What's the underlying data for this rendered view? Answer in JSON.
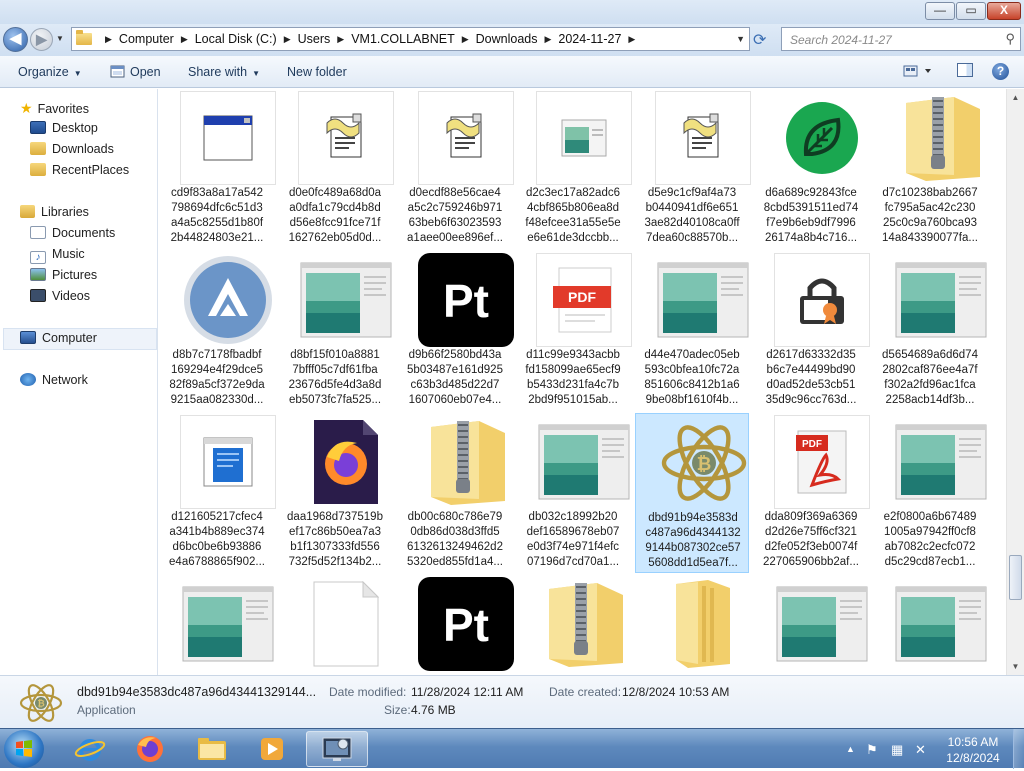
{
  "window": {
    "min_label": "—",
    "max_label": "▭",
    "close_label": "X"
  },
  "navbar": {
    "breadcrumbs": [
      "Computer",
      "Local Disk (C:)",
      "Users",
      "VM1.COLLABNET",
      "Downloads",
      "2024-11-27"
    ],
    "search_placeholder": "Search 2024-11-27"
  },
  "toolbar": {
    "organize_label": "Organize",
    "open_label": "Open",
    "share_label": "Share with",
    "new_folder_label": "New folder",
    "help_label": "?"
  },
  "sidebar": {
    "favorites": "Favorites",
    "favorites_items": [
      "Desktop",
      "Downloads",
      "RecentPlaces"
    ],
    "libraries": "Libraries",
    "library_items": [
      "Documents",
      "Music",
      "Pictures",
      "Videos"
    ],
    "computer": "Computer",
    "network": "Network"
  },
  "files": [
    {
      "name": "cd9f83a8a17a542\n798694dfc6c51d3\na4a5c8255d1b80f\n2b44824803e21...",
      "icon": "window-app-icon"
    },
    {
      "name": "d0e0fc489a68d0a\na0dfa1c79cd4b8d\nd56e8fcc91fce71f\n162762eb05d0d...",
      "icon": "script-icon"
    },
    {
      "name": "d0ecdf88e56cae4\na5c2c759246b971\n63beb6f63023593\na1aee00ee896ef...",
      "icon": "script-icon"
    },
    {
      "name": "d2c3ec17a82adc6\n4cbf865b806ea8d\nf48efcee31a55e5e\ne6e61de3dccbb...",
      "icon": "screenshot-small-icon"
    },
    {
      "name": "d5e9c1cf9af4a73\nb0440941df6e651\n3ae82d40108ca0ff\n7dea60c88570b...",
      "icon": "script-icon"
    },
    {
      "name": "d6a689c92843fce\n8cbd5391511ed74\nf7e9b6eb9df7996\n26174a8b4c716...",
      "icon": "leaf-app-icon"
    },
    {
      "name": "d7c10238bab2667\nfc795a5ac42c230\n25c0c9a760bca93\n14a843390077fa...",
      "icon": "zip-folder-icon"
    },
    {
      "name": "d8b7c7178fbadbf\n169294e4f29dce5\n82f89a5cf372e9da\n9215aa082330d...",
      "icon": "circle-logo-icon"
    },
    {
      "name": "d8bf15f010a8881\n7bfff05c7df61fba\n23676d5fe4d3a8d\neb5073fc7fa525...",
      "icon": "screenshot-icon"
    },
    {
      "name": "d9b66f2580bd43a\n5b03487e161d925\nc63b3d485d22d7\n1607060eb07e4...",
      "icon": "pt-app-icon"
    },
    {
      "name": "d11c99e9343acbb\nfd158099ae65ecf9\nb5433d231fa4c7b\n2bd9f951015ab...",
      "icon": "pdf-icon"
    },
    {
      "name": "d44e470adec05eb\n593c0bfea10fc72a\n851606c8412b1a6\n9be08bf1610f4b...",
      "icon": "screenshot-icon"
    },
    {
      "name": "d2617d63332d35\nb6c7e44499bd90\nd0ad52de53cb51\n35d9c96cc763d...",
      "icon": "certificate-lock-icon"
    },
    {
      "name": "d5654689a6d6d74\n2802caf876ee4a7f\nf302a2fd96ac1fca\n2258acb14df3b...",
      "icon": "screenshot-icon"
    },
    {
      "name": "d121605217cfec4\na341b4b889ec374\nd6bc0be6b93886\ne4a6788865f902...",
      "icon": "doc-window-icon"
    },
    {
      "name": "daa1968d737519b\nef17c86b50ea7a3\nb1f1307333fd556\n732f5d52f134b2...",
      "icon": "firefox-file-icon"
    },
    {
      "name": "db00c680c786e79\n0db86d038d3ffd5\n6132613249462d2\n5320ed855fd1a4...",
      "icon": "zip-folder-icon"
    },
    {
      "name": "db032c18992b20\ndef16589678eb07\ne0d3f74e971f4efc\n07196d7cd70a1...",
      "icon": "screenshot-icon"
    },
    {
      "name": "dbd91b94e3583d\nc487a96d4344132\n9144b087302ce57\n5608dd1d5ea7f...",
      "icon": "atom-app-icon",
      "selected": true
    },
    {
      "name": "dda809f369a6369\nd2d26e75ff6cf321\nd2fe052f3eb0074f\n227065906bb2af...",
      "icon": "pdf-acrobat-icon"
    },
    {
      "name": "e2f0800a6b67489\n1005a97942ff0cf8\nab7082c2ecfc072\nd5c29cd87ecb1...",
      "icon": "screenshot-icon"
    },
    {
      "name": "",
      "icon": "screenshot-icon"
    },
    {
      "name": "",
      "icon": "blank-file-icon"
    },
    {
      "name": "",
      "icon": "pt-app-icon"
    },
    {
      "name": "",
      "icon": "zip-folder-icon"
    },
    {
      "name": "",
      "icon": "open-folder-icon"
    },
    {
      "name": "",
      "icon": "screenshot-icon"
    },
    {
      "name": "",
      "icon": "screenshot-icon"
    }
  ],
  "details": {
    "name": "dbd91b94e3583dc487a96d43441329144...",
    "type": "Application",
    "modified_label": "Date modified:",
    "modified_value": "11/28/2024 12:11 AM",
    "created_label": "Date created:",
    "created_value": "12/8/2024 10:53 AM",
    "size_label": "Size:",
    "size_value": "4.76 MB"
  },
  "taskbar": {
    "time": "10:56 AM",
    "date": "12/8/2024",
    "tray_expand": "▲"
  }
}
